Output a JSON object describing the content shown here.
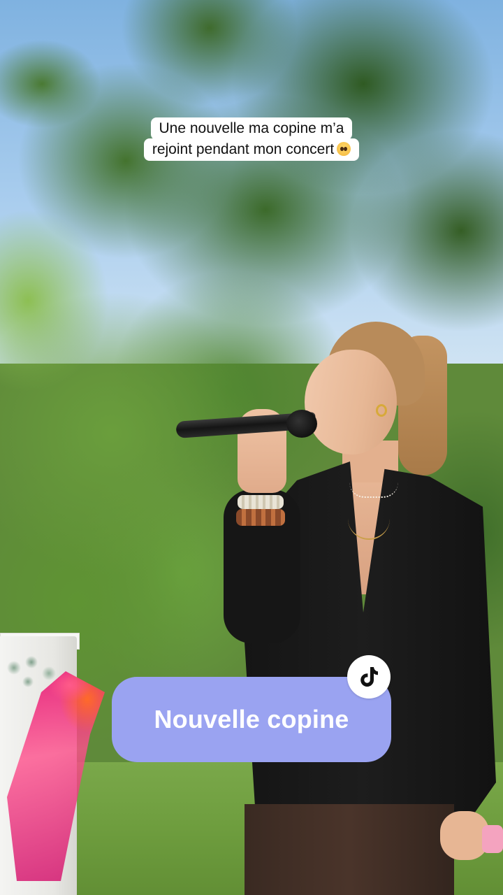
{
  "caption": {
    "line1": "Une nouvelle ma copine m’a",
    "line2": "rejoint pendant mon concert",
    "emoji": "pleading-face"
  },
  "sticker": {
    "label": "Nouvelle copine",
    "icon": "tiktok-icon",
    "background_color": "#9aa3f1"
  }
}
